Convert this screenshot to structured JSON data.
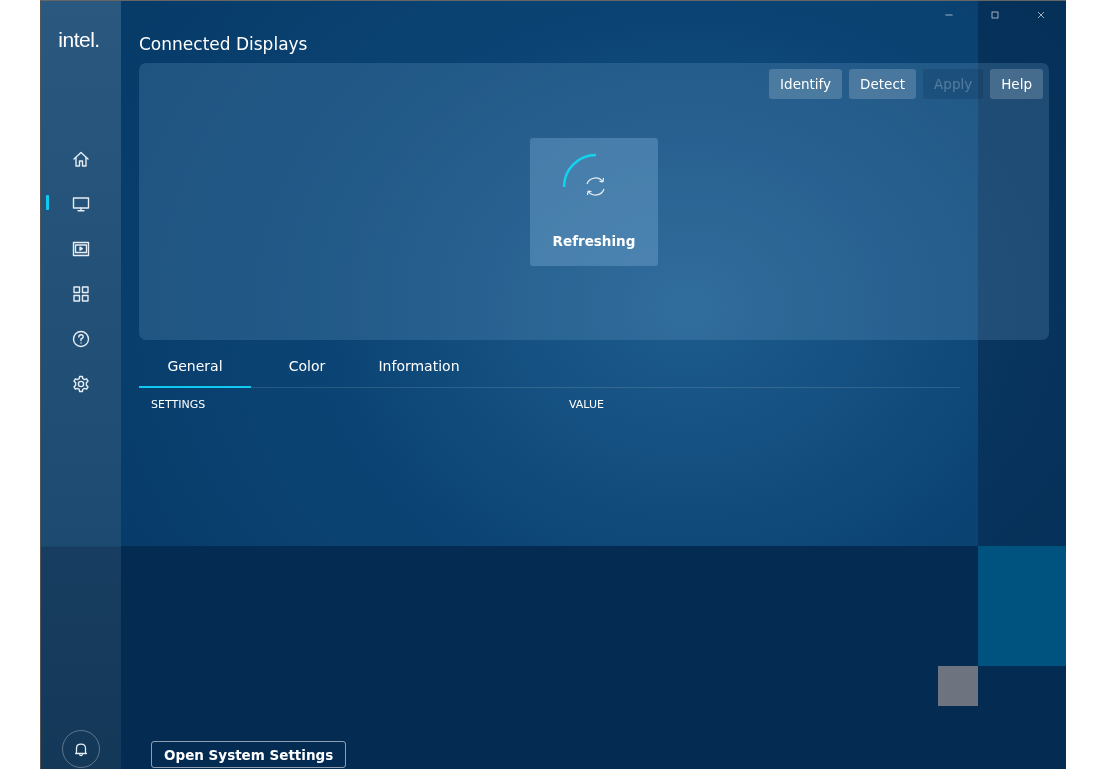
{
  "logo": "intel.",
  "sidebar": {
    "items": [
      {
        "kind": "home",
        "selected": false
      },
      {
        "kind": "display",
        "selected": true
      },
      {
        "kind": "media",
        "selected": false
      },
      {
        "kind": "apps",
        "selected": false
      },
      {
        "kind": "help",
        "selected": false
      },
      {
        "kind": "settings",
        "selected": false
      }
    ]
  },
  "title": "Connected Displays",
  "toolbar": [
    {
      "label": "Identify",
      "disabled": false
    },
    {
      "label": "Detect",
      "disabled": false
    },
    {
      "label": "Apply",
      "disabled": true
    },
    {
      "label": "Help",
      "disabled": false
    }
  ],
  "status_card": {
    "label": "Refreshing"
  },
  "tabs": [
    {
      "label": "General",
      "selected": true
    },
    {
      "label": "Color",
      "selected": false
    },
    {
      "label": "Information",
      "selected": false
    }
  ],
  "table": {
    "columns": [
      "SETTINGS",
      "VALUE"
    ]
  },
  "footer_button": "Open System Settings"
}
